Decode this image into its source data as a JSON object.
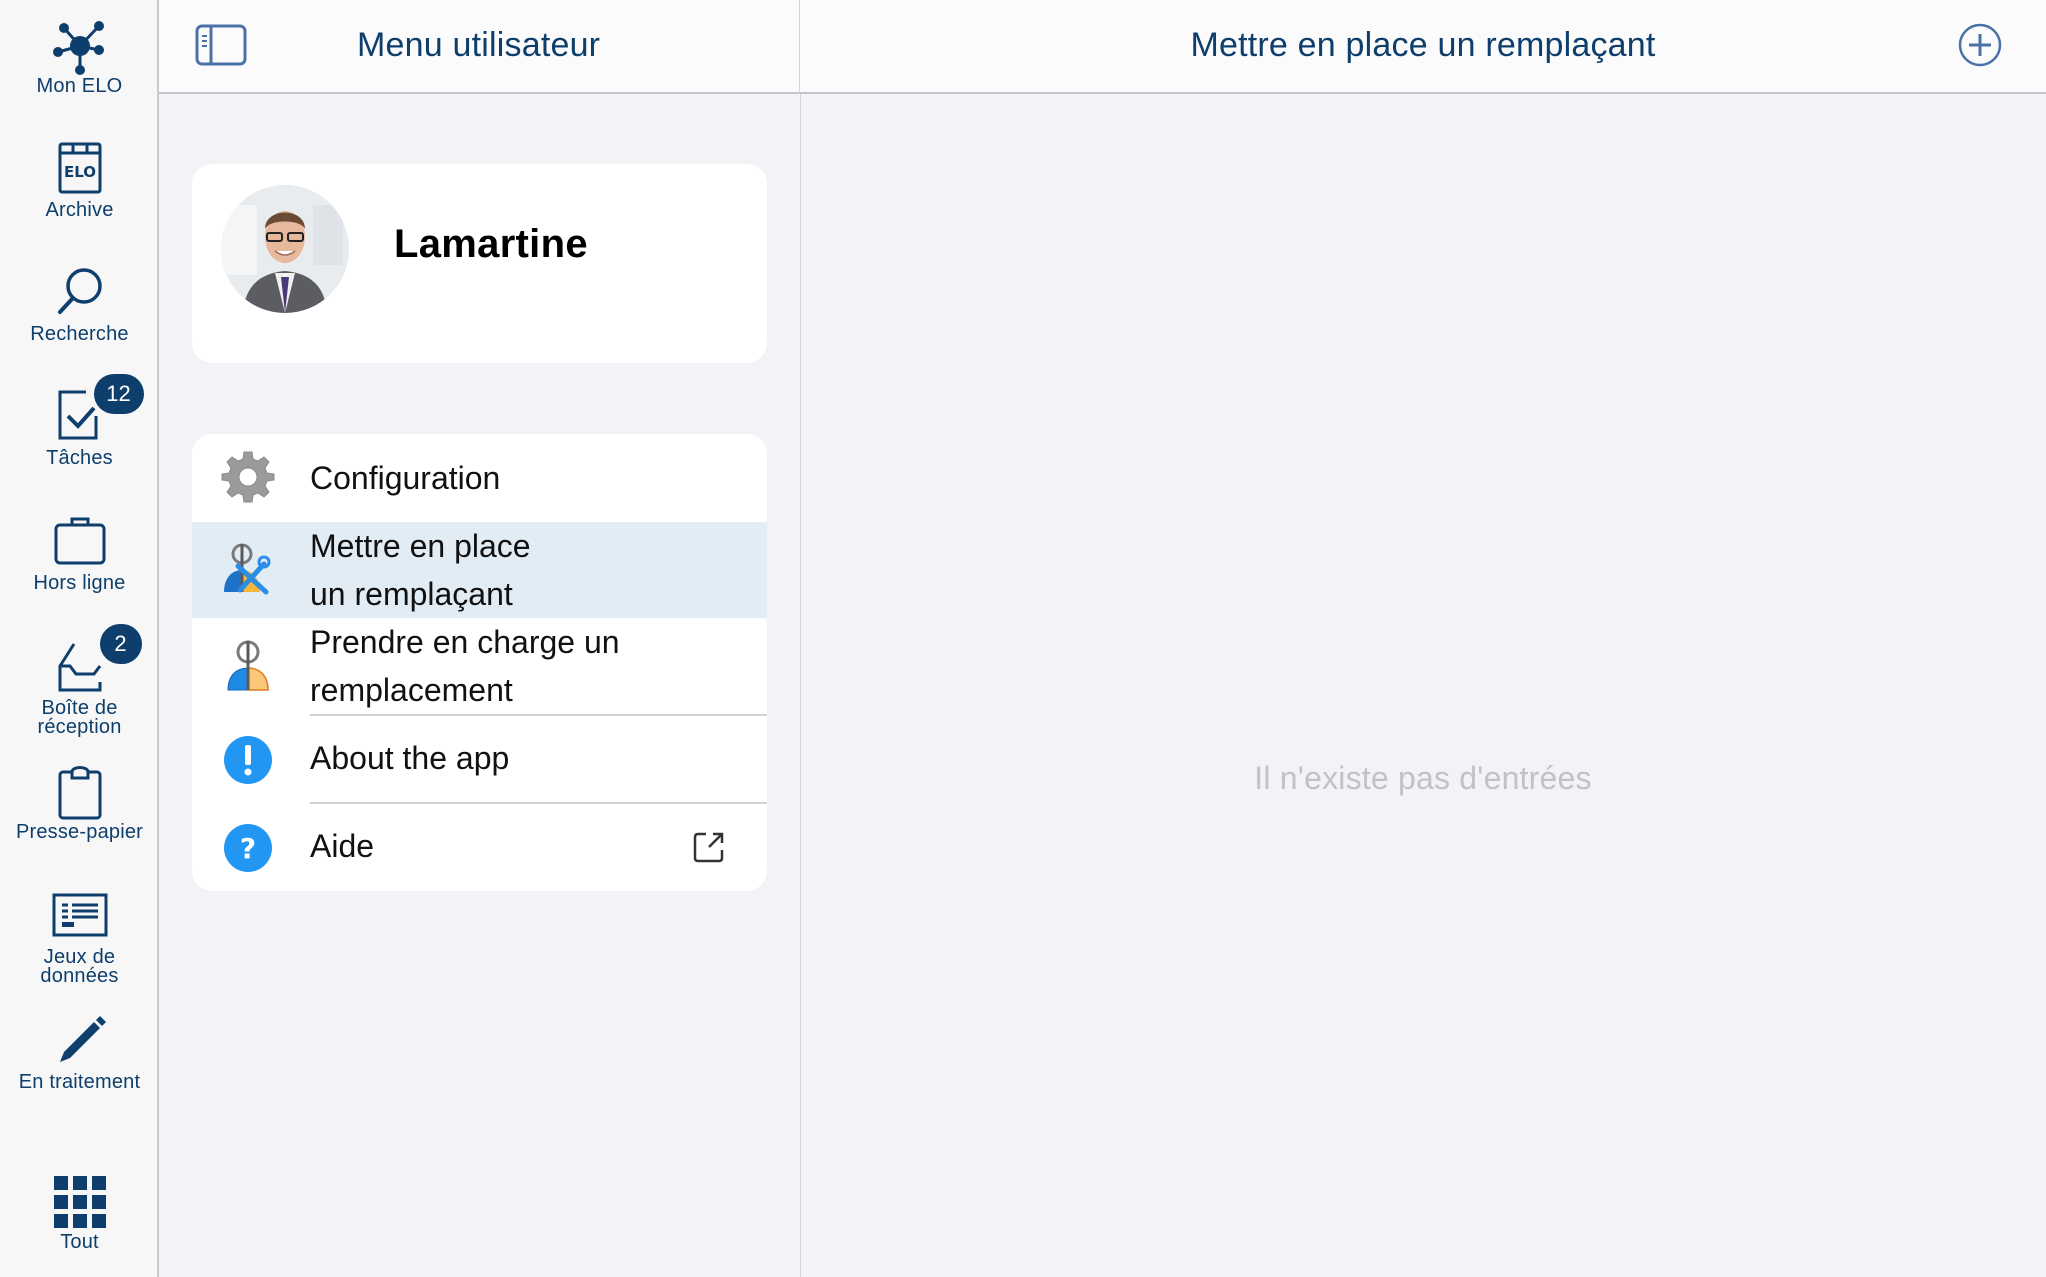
{
  "nav": {
    "items": [
      {
        "label": "Mon ELO",
        "icon": "network-hub-icon"
      },
      {
        "label": "Archive",
        "icon": "elo-archive-icon"
      },
      {
        "label": "Recherche",
        "icon": "search-icon"
      },
      {
        "label": "Tâches",
        "icon": "task-check-icon",
        "badge": "12"
      },
      {
        "label": "Hors ligne",
        "icon": "briefcase-icon"
      },
      {
        "label_line1": "Boîte de",
        "label_line2": "réception",
        "icon": "inbox-tray-icon",
        "badge": "2"
      },
      {
        "label": "Presse-papier",
        "icon": "clipboard-icon"
      },
      {
        "label_line1": "Jeux de",
        "label_line2": "données",
        "icon": "dataset-list-icon"
      },
      {
        "label": "En traitement",
        "icon": "pencil-icon"
      },
      {
        "label": "Tout",
        "icon": "grid-apps-icon"
      }
    ]
  },
  "header_left": {
    "title": "Menu utilisateur",
    "toggle_icon": "sidebar-toggle-icon"
  },
  "header_right": {
    "title": "Mettre en place un remplaçant",
    "add_icon": "add-circle-icon"
  },
  "profile": {
    "name": "Lamartine"
  },
  "menu": {
    "items": [
      {
        "label": "Configuration",
        "icon": "gear-icon"
      },
      {
        "label_line1": "Mettre en place",
        "label_line2": "un remplaçant",
        "icon": "substitute-setup-icon",
        "selected": true
      },
      {
        "label_line1": "Prendre en charge un",
        "label_line2": "remplacement",
        "icon": "substitute-takeover-icon"
      },
      {
        "label": "About the app",
        "icon": "info-exclamation-icon"
      },
      {
        "label": "Aide",
        "icon": "help-question-icon",
        "trailing_icon": "external-link-icon"
      }
    ]
  },
  "right_panel": {
    "empty_text": "Il n'existe pas d'entrées"
  },
  "colors": {
    "brand": "#0e3e6b",
    "selected_row": "#e2ecf5",
    "info_blue": "#2196f3",
    "empty_text": "#c2c2c6"
  }
}
